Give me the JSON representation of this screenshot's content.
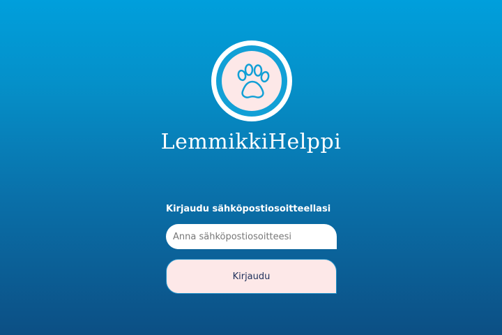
{
  "app": {
    "title": "LemmikkiHelppi",
    "logo_icon": "paw-icon"
  },
  "login": {
    "label": "Kirjaudu sähköpostiosoitteellasi",
    "email_value": "",
    "email_placeholder": "Anna sähköpostiosoitteesi",
    "button_label": "Kirjaudu"
  },
  "colors": {
    "background_top": "#009fdc",
    "background_bottom": "#0c4f84",
    "logo_ring": "#12a0d6",
    "logo_fill": "#fde8e8",
    "button_fill": "#fde8e8",
    "button_text": "#1d2f5a"
  }
}
